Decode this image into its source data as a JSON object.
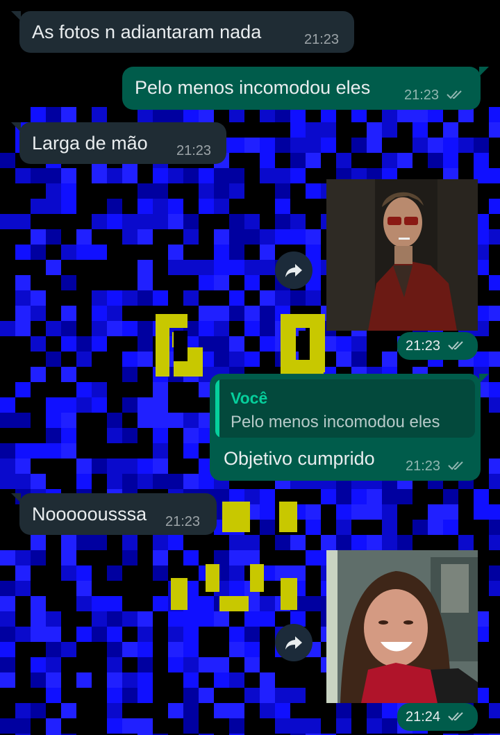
{
  "chat": {
    "messages": [
      {
        "direction": "in",
        "text": "As fotos n adiantaram nada",
        "time": "21:23"
      },
      {
        "direction": "out",
        "text": "Pelo menos incomodou eles",
        "time": "21:23",
        "read": true
      },
      {
        "direction": "in",
        "text": "Larga de mão",
        "time": "21:23"
      },
      {
        "direction": "out",
        "type": "image",
        "image": "man-in-red-leather-jacket-with-sunglasses-photo",
        "time": "21:23",
        "read": true,
        "forward_icon": "forward-arrow-icon"
      },
      {
        "direction": "out",
        "reply_to": {
          "author": "Você",
          "text": "Pelo menos incomodou eles"
        },
        "text": "Objetivo cumprido",
        "time": "21:23",
        "read": true
      },
      {
        "direction": "in",
        "text": "Nooooousssa",
        "time": "21:23"
      },
      {
        "direction": "out",
        "type": "image",
        "image": "laughing-girl-photo",
        "time": "21:24",
        "read": true,
        "forward_icon": "forward-arrow-icon"
      }
    ]
  },
  "colors": {
    "incoming_bubble": "#1f2c34",
    "outgoing_bubble": "#005c4b",
    "reply_accent": "#06cf9c",
    "wallpaper_blue": "#1010ff",
    "wallpaper_yellow": "#c8c800"
  },
  "icons": {
    "read_receipt": "double-check-icon",
    "forward": "forward-arrow-icon"
  }
}
